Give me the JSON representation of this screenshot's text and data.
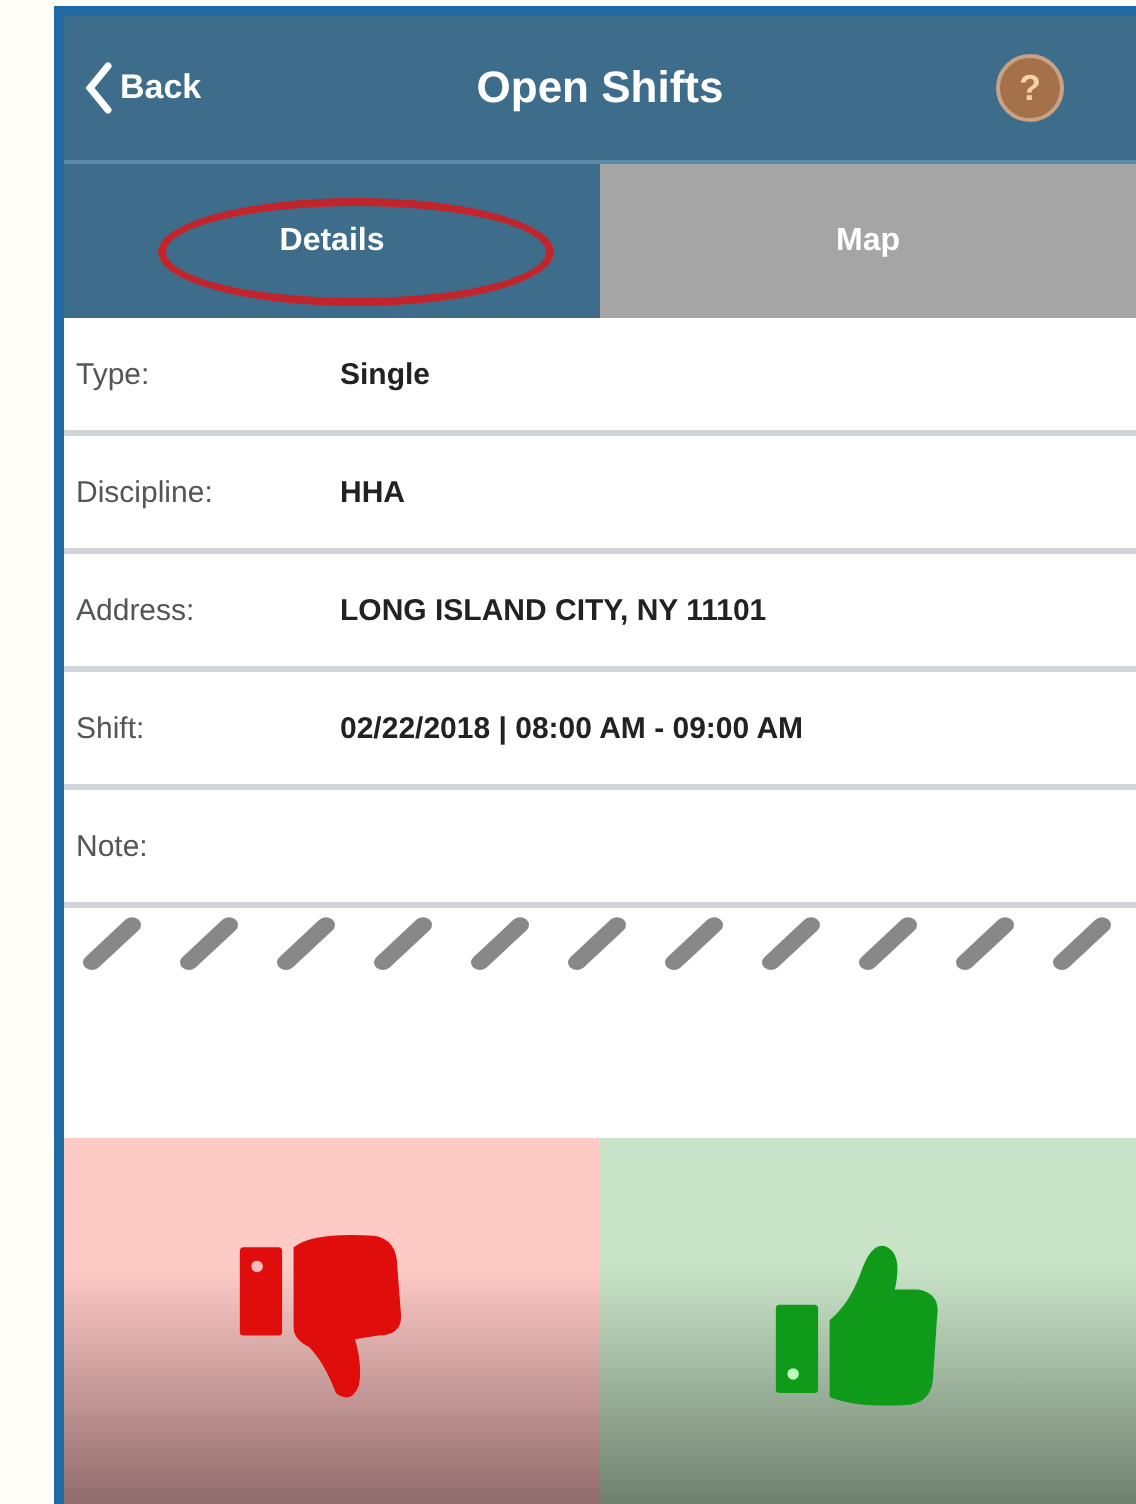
{
  "header": {
    "back": "Back",
    "title": "Open Shifts",
    "help": "?"
  },
  "tabs": [
    {
      "label": "Details",
      "selected": true
    },
    {
      "label": "Map",
      "selected": false
    }
  ],
  "fields": [
    {
      "label": "Type:",
      "value": "Single"
    },
    {
      "label": "Discipline:",
      "value": "HHA"
    },
    {
      "label": "Address:",
      "value": "LONG ISLAND CITY, NY 11101"
    },
    {
      "label": "Shift:",
      "value": "02/22/2018 | 08:00 AM - 09:00 AM"
    },
    {
      "label": "Note:"
    }
  ]
}
